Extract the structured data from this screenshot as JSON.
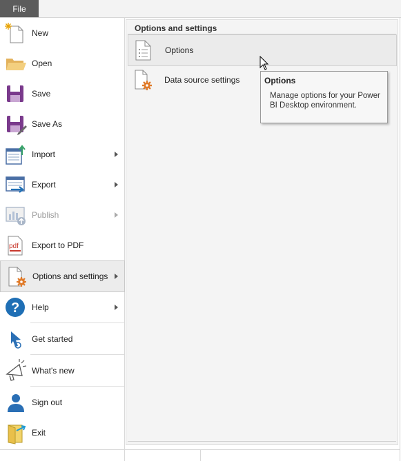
{
  "file_tab": {
    "label": "File"
  },
  "menu": {
    "items": [
      {
        "label": "New",
        "icon": "new-document-icon"
      },
      {
        "label": "Open",
        "icon": "folder-open-icon"
      },
      {
        "label": "Save",
        "icon": "save-icon"
      },
      {
        "label": "Save As",
        "icon": "save-as-icon"
      },
      {
        "label": "Import",
        "icon": "import-icon"
      },
      {
        "label": "Export",
        "icon": "export-icon"
      },
      {
        "label": "Publish",
        "icon": "publish-icon"
      },
      {
        "label": "Export to PDF",
        "icon": "pdf-icon"
      },
      {
        "label": "Options and settings",
        "icon": "options-settings-icon"
      },
      {
        "label": "Help",
        "icon": "help-icon"
      },
      {
        "label": "Get started",
        "icon": "get-started-icon"
      },
      {
        "label": "What's new",
        "icon": "megaphone-icon"
      },
      {
        "label": "Sign out",
        "icon": "user-icon"
      },
      {
        "label": "Exit",
        "icon": "exit-icon"
      }
    ]
  },
  "panel": {
    "title": "Options and settings",
    "items": [
      {
        "label": "Options",
        "icon": "options-list-icon"
      },
      {
        "label": "Data source settings",
        "icon": "data-source-settings-icon"
      }
    ]
  },
  "tooltip": {
    "title": "Options",
    "body": "Manage options for your Power BI Desktop environment."
  },
  "colors": {
    "file_tab_bg": "#5c5c5c",
    "accent_orange": "#e07b2a",
    "help_blue": "#1f6fb5",
    "save_purple": "#7a3a8c"
  }
}
